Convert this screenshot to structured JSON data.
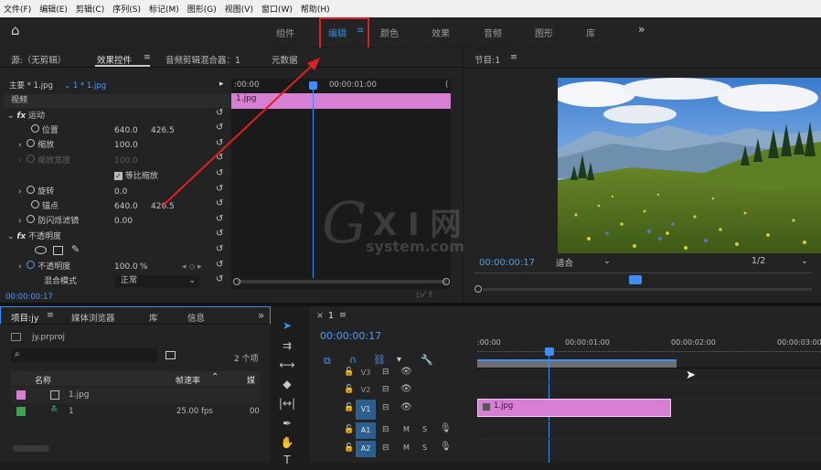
{
  "menu": [
    "文件(F)",
    "编辑(E)",
    "剪辑(C)",
    "序列(S)",
    "标记(M)",
    "图形(G)",
    "视图(V)",
    "窗口(W)",
    "帮助(H)"
  ],
  "workspace": {
    "home": "⌂",
    "tabs": [
      "组件",
      "编辑",
      "颜色",
      "效果",
      "音频",
      "图形",
      "库"
    ],
    "active_menu": "≡",
    "more": "»"
  },
  "source_tabs": {
    "source": "源:（无剪辑）",
    "effect_controls": "效果控件",
    "menu": "≡",
    "audio_mixer": "音频剪辑混合器：1",
    "metadata": "元数据"
  },
  "effect_controls": {
    "master": "主要 * 1.jpg",
    "clip": "1 * 1.jpg",
    "ruler_start": ":00:00",
    "ruler_mid": "00:00:01:00",
    "clip_label": "1.jpg",
    "section_video": "视频",
    "motion": "运动",
    "position": "位置",
    "position_x": "640.0",
    "position_y": "426.5",
    "scale": "缩放",
    "scale_val": "100.0",
    "scale_width": "缩放宽度",
    "scale_width_val": "100.0",
    "uniform_scale": "等比缩放",
    "rotation": "旋转",
    "rotation_val": "0.0",
    "anchor": "锚点",
    "anchor_x": "640.0",
    "anchor_y": "426.5",
    "antiflicker": "防闪烁滤镜",
    "antiflicker_val": "0.00",
    "opacity_section": "不透明度",
    "opacity": "不透明度",
    "opacity_val": "100.0",
    "opacity_unit": "%",
    "blend_mode": "混合模式",
    "blend_val": "正常",
    "timecode": "00:00:00:17"
  },
  "program": {
    "title": "节目:1",
    "menu": "≡",
    "timecode": "00:00:00:17",
    "fit": "适合",
    "resolution": "1/2"
  },
  "project": {
    "title": "项目:jy",
    "menu": "≡",
    "media_browser": "媒体浏览器",
    "library": "库",
    "info": "信息",
    "more": "»",
    "file": "jy.prproj",
    "count": "2 个项",
    "col_name": "名称",
    "col_fps": "帧速率",
    "col_media": "媒",
    "items": [
      {
        "name": "1.jpg",
        "fps": "",
        "extra": ""
      },
      {
        "name": "1",
        "fps": "25.00 fps",
        "extra": "00"
      }
    ]
  },
  "timeline": {
    "close": "×",
    "name": "1",
    "menu": "≡",
    "timecode": "00:00:00:17",
    "ruler": [
      ":00:00",
      "00:00:01:00",
      "00:00:02:00",
      "00:00:03:00"
    ],
    "video_tracks": [
      "V3",
      "V2",
      "V1"
    ],
    "audio_tracks": [
      "A1",
      "A2"
    ],
    "clip_label": "1.jpg"
  },
  "colors": {
    "accent": "#2d8ceb",
    "clip_pink": "#d77fd3",
    "highlight_red": "#e02020"
  }
}
